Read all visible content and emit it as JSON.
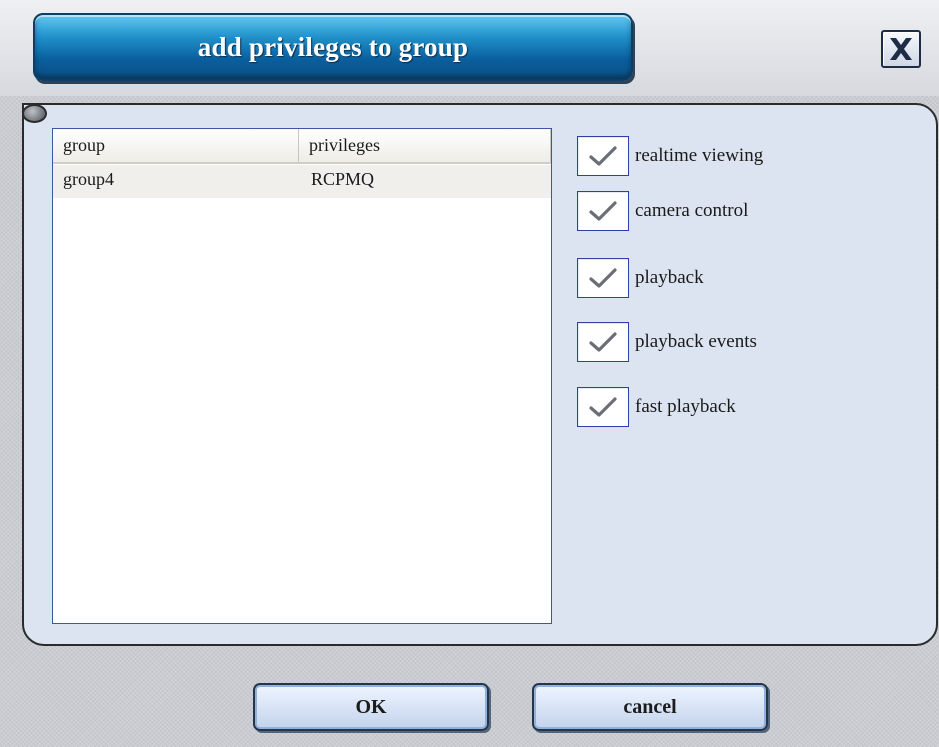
{
  "dialog": {
    "title": "add privileges to group",
    "close_icon": "close-x-icon"
  },
  "list": {
    "columns": [
      "group",
      "privileges"
    ],
    "rows": [
      {
        "group": "group4",
        "privileges": "RCPMQ"
      }
    ]
  },
  "privileges": [
    {
      "label": "realtime viewing",
      "checked": true
    },
    {
      "label": "camera control",
      "checked": true
    },
    {
      "label": "playback",
      "checked": true
    },
    {
      "label": "playback events",
      "checked": true
    },
    {
      "label": "fast playback",
      "checked": true
    }
  ],
  "buttons": {
    "ok": "OK",
    "cancel": "cancel"
  },
  "colors": {
    "title_banner": "#1f90c9",
    "panel": "#dbe4f0",
    "list_border": "#3d56a6",
    "button": "#c2d3ec"
  }
}
